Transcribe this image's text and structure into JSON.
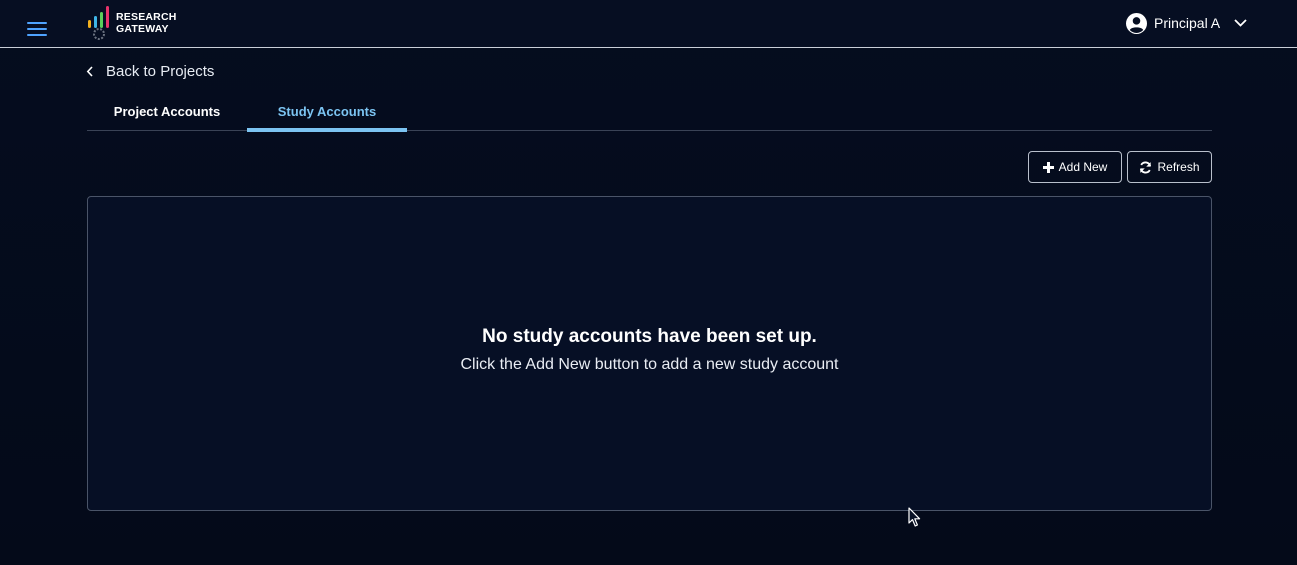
{
  "header": {
    "logo_line1": "RESEARCH",
    "logo_line2": "GATEWAY",
    "user_name": "Principal A",
    "accent": "#4fa3ff"
  },
  "nav": {
    "back_label": "Back to Projects"
  },
  "tabs": [
    {
      "label": "Project Accounts",
      "active": false
    },
    {
      "label": "Study Accounts",
      "active": true
    }
  ],
  "toolbar": {
    "add_label": "Add New",
    "refresh_label": "Refresh"
  },
  "empty_state": {
    "title": "No study accounts have been set up.",
    "subtitle": "Click the Add New button to add a new study account"
  },
  "icons": {
    "menu": "hamburger-icon",
    "user": "user-circle-icon",
    "dropdown": "chevron-down-icon",
    "back": "chevron-left-icon",
    "add": "plus-icon",
    "refresh": "refresh-icon"
  },
  "colors": {
    "active_tab": "#7cc4f2",
    "background": "#050d1f"
  }
}
